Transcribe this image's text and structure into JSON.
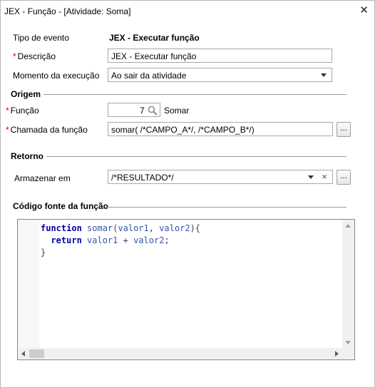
{
  "window": {
    "title": "JEX - Função - [Atividade: Soma]",
    "close_glyph": "✕"
  },
  "form": {
    "tipo_evento_label": "Tipo de evento",
    "tipo_evento_value": "JEX - Executar função",
    "descricao_label": "Descrição",
    "descricao_value": "JEX - Executar função",
    "momento_label": "Momento da execução",
    "momento_value": "Ao sair da atividade",
    "required_mark": "*"
  },
  "origem": {
    "title": "Origem",
    "funcao_label": "Função",
    "funcao_id": "7",
    "funcao_name": "Somar",
    "chamada_label": "Chamada da função",
    "chamada_value": "somar( /*CAMPO_A*/, /*CAMPO_B*/)",
    "chamada_button": "..."
  },
  "retorno": {
    "title": "Retorno",
    "armazenar_label": "Armazenar em",
    "armazenar_value": "/*RESULTADO*/",
    "clear_glyph": "×",
    "armazenar_button": "..."
  },
  "codigo": {
    "title": "Código fonte da função",
    "line1": {
      "kw": "function",
      "name": " somar",
      "open": "(",
      "p1": "valor1",
      "sep": ", ",
      "p2": "valor2",
      "close": "){"
    },
    "line2": {
      "indent": "  ",
      "kw": "return",
      "a": " valor1",
      "op": " + ",
      "b": "valor2",
      "end": ";"
    },
    "line3": "}"
  },
  "colors": {
    "required": "#d00000",
    "keyword": "#0000aa",
    "identifier": "#3355aa"
  },
  "icons": {
    "search": "magnifier-icon",
    "dropdown": "chevron-down-icon"
  }
}
